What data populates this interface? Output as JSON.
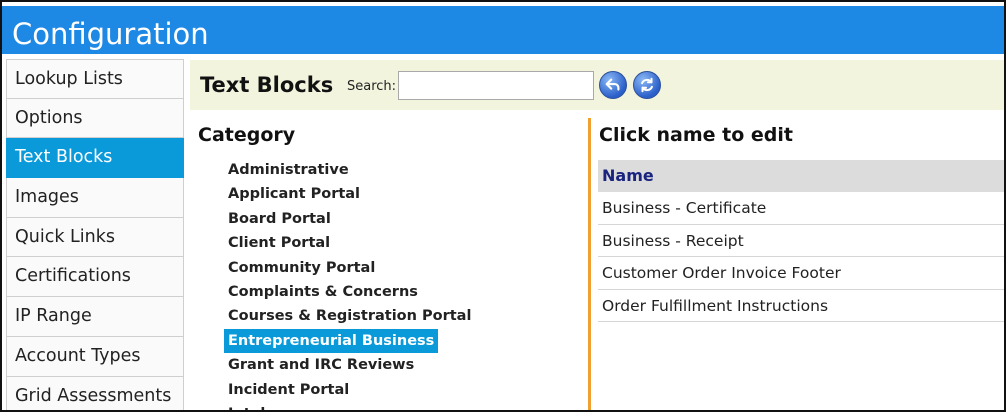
{
  "window": {
    "title": "Configuration"
  },
  "sidebar": {
    "items": [
      {
        "label": "Lookup Lists"
      },
      {
        "label": "Options"
      },
      {
        "label": "Text Blocks",
        "active": true
      },
      {
        "label": "Images"
      },
      {
        "label": "Quick Links"
      },
      {
        "label": "Certifications"
      },
      {
        "label": "IP Range"
      },
      {
        "label": "Account Types"
      },
      {
        "label": "Grid Assessments"
      }
    ]
  },
  "toolbar": {
    "heading": "Text Blocks",
    "search_label": "Search:",
    "search_value": "",
    "back_icon": "back-arrow-icon",
    "refresh_icon": "refresh-icon"
  },
  "category": {
    "title": "Category",
    "items": [
      {
        "label": "Administrative"
      },
      {
        "label": "Applicant Portal"
      },
      {
        "label": "Board Portal"
      },
      {
        "label": "Client Portal"
      },
      {
        "label": "Community Portal"
      },
      {
        "label": "Complaints & Concerns"
      },
      {
        "label": "Courses & Registration Portal"
      },
      {
        "label": "Entrepreneurial Business",
        "active": true
      },
      {
        "label": "Grant and IRC Reviews"
      },
      {
        "label": "Incident Portal"
      },
      {
        "label": "Intake"
      }
    ]
  },
  "names": {
    "title": "Click name to edit",
    "column_header": "Name",
    "rows": [
      {
        "name": "Business - Certificate"
      },
      {
        "name": "Business - Receipt"
      },
      {
        "name": "Customer Order Invoice Footer"
      },
      {
        "name": "Order Fulfillment Instructions"
      }
    ]
  },
  "colors": {
    "title_bar": "#1e88e5",
    "active_item": "#0a9ad9",
    "toolbar_bg": "#f2f4de",
    "divider": "#f0a030",
    "table_header_text": "#1a237e"
  }
}
